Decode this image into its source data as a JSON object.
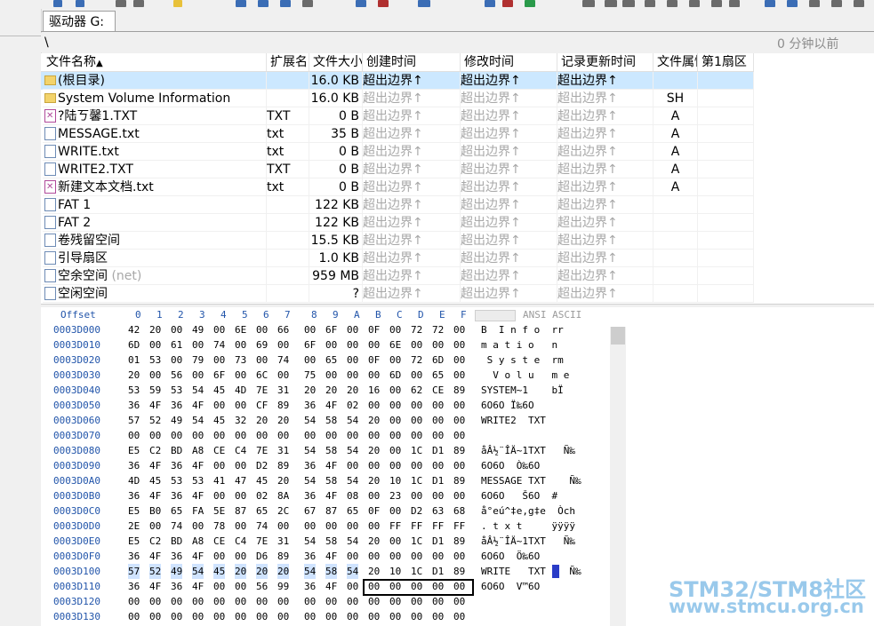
{
  "tab_label": "驱动器 G:",
  "path": "\\",
  "time_ago": "0 分钟以前",
  "columns": [
    "文件名称",
    "扩展名",
    "文件大小",
    "创建时间",
    "修改时间",
    "记录更新时间",
    "文件属性",
    "第1扇区"
  ],
  "files": [
    {
      "icon": "folder-icon",
      "name": "(根目录)",
      "ext": "",
      "size": "16.0 KB",
      "ctime": "超出边界↑",
      "mtime": "超出边界↑",
      "rtime": "超出边界↑",
      "attr": "",
      "sector": "",
      "selected": true
    },
    {
      "icon": "folder-icon",
      "name": "System Volume Information",
      "ext": "",
      "size": "16.0 KB",
      "ctime": "超出边界↑",
      "mtime": "超出边界↑",
      "rtime": "超出边界↑",
      "attr": "SH",
      "sector": ""
    },
    {
      "icon": "deleted-file-icon",
      "name": "?陆ㄎ馨1.TXT",
      "ext": "TXT",
      "size": "0 B",
      "ctime": "超出边界↑",
      "mtime": "超出边界↑",
      "rtime": "超出边界↑",
      "attr": "A",
      "sector": ""
    },
    {
      "icon": "file-icon",
      "name": "MESSAGE.txt",
      "ext": "txt",
      "size": "35 B",
      "ctime": "超出边界↑",
      "mtime": "超出边界↑",
      "rtime": "超出边界↑",
      "attr": "A",
      "sector": ""
    },
    {
      "icon": "file-icon",
      "name": "WRITE.txt",
      "ext": "txt",
      "size": "0 B",
      "ctime": "超出边界↑",
      "mtime": "超出边界↑",
      "rtime": "超出边界↑",
      "attr": "A",
      "sector": ""
    },
    {
      "icon": "file-icon",
      "name": "WRITE2.TXT",
      "ext": "TXT",
      "size": "0 B",
      "ctime": "超出边界↑",
      "mtime": "超出边界↑",
      "rtime": "超出边界↑",
      "attr": "A",
      "sector": ""
    },
    {
      "icon": "deleted-file-icon",
      "name": "新建文本文档.txt",
      "ext": "txt",
      "size": "0 B",
      "ctime": "超出边界↑",
      "mtime": "超出边界↑",
      "rtime": "超出边界↑",
      "attr": "A",
      "sector": ""
    },
    {
      "icon": "file-icon",
      "name": "FAT 1",
      "ext": "",
      "size": "122 KB",
      "ctime": "超出边界↑",
      "mtime": "超出边界↑",
      "rtime": "超出边界↑",
      "attr": "",
      "sector": ""
    },
    {
      "icon": "file-icon",
      "name": "FAT 2",
      "ext": "",
      "size": "122 KB",
      "ctime": "超出边界↑",
      "mtime": "超出边界↑",
      "rtime": "超出边界↑",
      "attr": "",
      "sector": ""
    },
    {
      "icon": "file-icon",
      "name": "卷残留空间",
      "ext": "",
      "size": "15.5 KB",
      "ctime": "超出边界↑",
      "mtime": "超出边界↑",
      "rtime": "超出边界↑",
      "attr": "",
      "sector": ""
    },
    {
      "icon": "file-icon",
      "name": "引导扇区",
      "ext": "",
      "size": "1.0 KB",
      "ctime": "超出边界↑",
      "mtime": "超出边界↑",
      "rtime": "超出边界↑",
      "attr": "",
      "sector": ""
    },
    {
      "icon": "file-icon",
      "name": "空余空间",
      "name_suffix": " (net)",
      "ext": "",
      "size": "959 MB",
      "ctime": "超出边界↑",
      "mtime": "超出边界↑",
      "rtime": "超出边界↑",
      "attr": "",
      "sector": ""
    },
    {
      "icon": "file-icon",
      "name": "空闲空间",
      "ext": "",
      "size": "?",
      "ctime": "超出边界↑",
      "mtime": "超出边界↑",
      "rtime": "超出边界↑",
      "attr": "",
      "sector": ""
    }
  ],
  "hex_header": {
    "offset_label": "Offset",
    "columns": [
      "0",
      "1",
      "2",
      "3",
      "4",
      "5",
      "6",
      "7",
      "8",
      "9",
      "A",
      "B",
      "C",
      "D",
      "E",
      "F"
    ],
    "charset_label": "ANSI ASCII"
  },
  "hex_rows": [
    {
      "offset": "0003D000",
      "bytes": [
        "42",
        "20",
        "00",
        "49",
        "00",
        "6E",
        "00",
        "66",
        "00",
        "6F",
        "00",
        "0F",
        "00",
        "72",
        "72",
        "00"
      ],
      "ascii": "B  I n f o  rr"
    },
    {
      "offset": "0003D010",
      "bytes": [
        "6D",
        "00",
        "61",
        "00",
        "74",
        "00",
        "69",
        "00",
        "6F",
        "00",
        "00",
        "00",
        "6E",
        "00",
        "00",
        "00"
      ],
      "ascii": "m a t i o   n"
    },
    {
      "offset": "0003D020",
      "bytes": [
        "01",
        "53",
        "00",
        "79",
        "00",
        "73",
        "00",
        "74",
        "00",
        "65",
        "00",
        "0F",
        "00",
        "72",
        "6D",
        "00"
      ],
      "ascii": " S y s t e  rm"
    },
    {
      "offset": "0003D030",
      "bytes": [
        "20",
        "00",
        "56",
        "00",
        "6F",
        "00",
        "6C",
        "00",
        "75",
        "00",
        "00",
        "00",
        "6D",
        "00",
        "65",
        "00"
      ],
      "ascii": "  V o l u   m e"
    },
    {
      "offset": "0003D040",
      "bytes": [
        "53",
        "59",
        "53",
        "54",
        "45",
        "4D",
        "7E",
        "31",
        "20",
        "20",
        "20",
        "16",
        "00",
        "62",
        "CE",
        "89"
      ],
      "ascii": "SYSTEM~1    bΪ"
    },
    {
      "offset": "0003D050",
      "bytes": [
        "36",
        "4F",
        "36",
        "4F",
        "00",
        "00",
        "CF",
        "89",
        "36",
        "4F",
        "02",
        "00",
        "00",
        "00",
        "00",
        "00"
      ],
      "ascii": "6O6O Ï‰6O"
    },
    {
      "offset": "0003D060",
      "bytes": [
        "57",
        "52",
        "49",
        "54",
        "45",
        "32",
        "20",
        "20",
        "54",
        "58",
        "54",
        "20",
        "00",
        "00",
        "00",
        "00"
      ],
      "ascii": "WRITE2  TXT"
    },
    {
      "offset": "0003D070",
      "bytes": [
        "00",
        "00",
        "00",
        "00",
        "00",
        "00",
        "00",
        "00",
        "00",
        "00",
        "00",
        "00",
        "00",
        "00",
        "00",
        "00"
      ],
      "ascii": ""
    },
    {
      "offset": "0003D080",
      "bytes": [
        "E5",
        "C2",
        "BD",
        "A8",
        "CE",
        "C4",
        "7E",
        "31",
        "54",
        "58",
        "54",
        "20",
        "00",
        "1C",
        "D1",
        "89"
      ],
      "ascii": "åÂ½¨ÎÄ~1TXT   Ñ‰"
    },
    {
      "offset": "0003D090",
      "bytes": [
        "36",
        "4F",
        "36",
        "4F",
        "00",
        "00",
        "D2",
        "89",
        "36",
        "4F",
        "00",
        "00",
        "00",
        "00",
        "00",
        "00"
      ],
      "ascii": "6O6O  Ò‰6O"
    },
    {
      "offset": "0003D0A0",
      "bytes": [
        "4D",
        "45",
        "53",
        "53",
        "41",
        "47",
        "45",
        "20",
        "54",
        "58",
        "54",
        "20",
        "10",
        "1C",
        "D1",
        "89"
      ],
      "ascii": "MESSAGE TXT    Ñ‰"
    },
    {
      "offset": "0003D0B0",
      "bytes": [
        "36",
        "4F",
        "36",
        "4F",
        "00",
        "00",
        "02",
        "8A",
        "36",
        "4F",
        "08",
        "00",
        "23",
        "00",
        "00",
        "00"
      ],
      "ascii": "6O6O   Š6O  #"
    },
    {
      "offset": "0003D0C0",
      "bytes": [
        "E5",
        "B0",
        "65",
        "FA",
        "5E",
        "87",
        "65",
        "2C",
        "67",
        "87",
        "65",
        "0F",
        "00",
        "D2",
        "63",
        "68"
      ],
      "ascii": "å°eú^‡e,g‡e  Òch"
    },
    {
      "offset": "0003D0D0",
      "bytes": [
        "2E",
        "00",
        "74",
        "00",
        "78",
        "00",
        "74",
        "00",
        "00",
        "00",
        "00",
        "00",
        "FF",
        "FF",
        "FF",
        "FF"
      ],
      "ascii": ". t x t     ÿÿÿÿ"
    },
    {
      "offset": "0003D0E0",
      "bytes": [
        "E5",
        "C2",
        "BD",
        "A8",
        "CE",
        "C4",
        "7E",
        "31",
        "54",
        "58",
        "54",
        "20",
        "00",
        "1C",
        "D1",
        "89"
      ],
      "ascii": "åÂ½¨ÎÄ~1TXT   Ñ‰"
    },
    {
      "offset": "0003D0F0",
      "bytes": [
        "36",
        "4F",
        "36",
        "4F",
        "00",
        "00",
        "D6",
        "89",
        "36",
        "4F",
        "00",
        "00",
        "00",
        "00",
        "00",
        "00"
      ],
      "ascii": "6O6O  Ö‰6O"
    },
    {
      "offset": "0003D100",
      "bytes": [
        "57",
        "52",
        "49",
        "54",
        "45",
        "20",
        "20",
        "20",
        "54",
        "58",
        "54",
        "20",
        "10",
        "1C",
        "D1",
        "89"
      ],
      "ascii": "WRITE   TXT    Ñ‰"
    },
    {
      "offset": "0003D110",
      "bytes": [
        "36",
        "4F",
        "36",
        "4F",
        "00",
        "00",
        "56",
        "99",
        "36",
        "4F",
        "00",
        "00",
        "00",
        "00",
        "00",
        "00"
      ],
      "ascii": "6O6O  V™6O"
    },
    {
      "offset": "0003D120",
      "bytes": [
        "00",
        "00",
        "00",
        "00",
        "00",
        "00",
        "00",
        "00",
        "00",
        "00",
        "00",
        "00",
        "00",
        "00",
        "00",
        "00"
      ],
      "ascii": ""
    },
    {
      "offset": "0003D130",
      "bytes": [
        "00",
        "00",
        "00",
        "00",
        "00",
        "00",
        "00",
        "00",
        "00",
        "00",
        "00",
        "00",
        "00",
        "00",
        "00",
        "00"
      ],
      "ascii": ""
    }
  ],
  "watermark": {
    "line1": "STM32/STM8社区",
    "line2": "www.stmcu.org.cn"
  }
}
